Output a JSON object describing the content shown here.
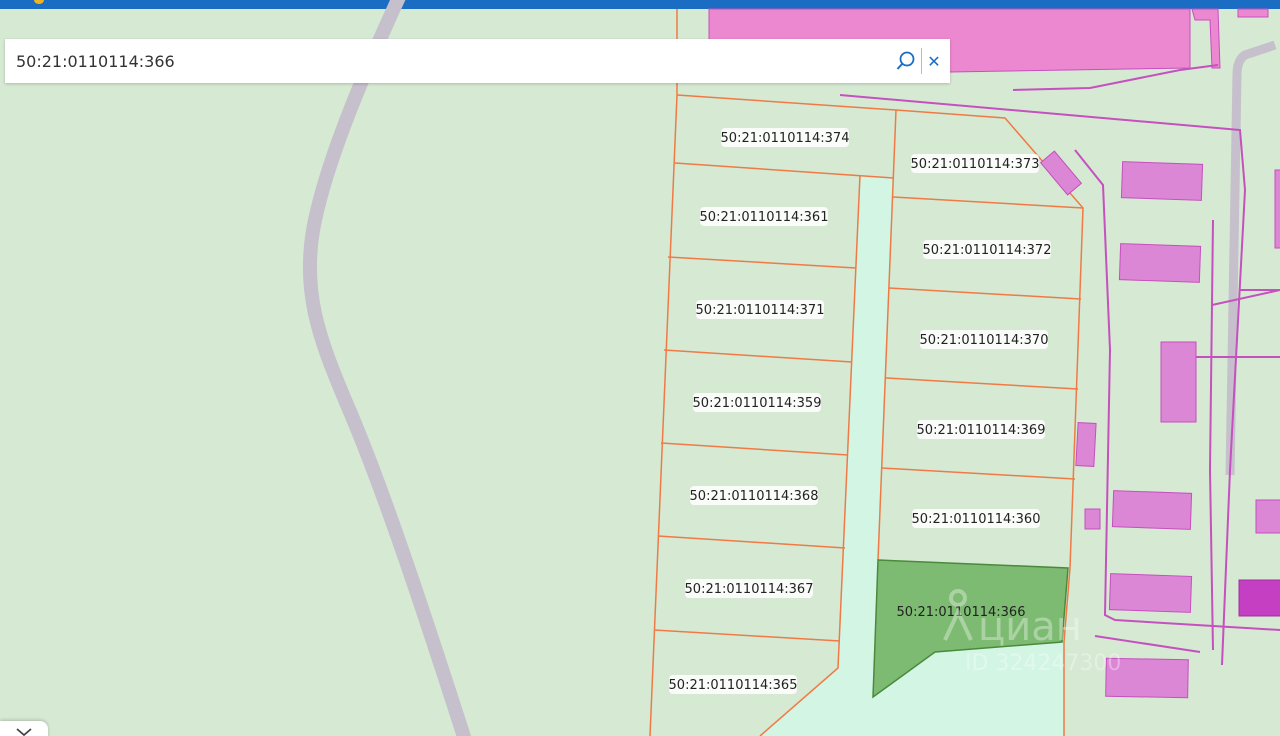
{
  "search": {
    "value": "50:21:0110114:366",
    "search_icon": "search-icon",
    "clear_icon": "close-icon"
  },
  "collapse_icon": "chevron-down-icon",
  "watermark": {
    "brand": "циан",
    "id": "ID 324247300"
  },
  "parcels": [
    {
      "id": "374",
      "label": "50:21:0110114:374"
    },
    {
      "id": "373",
      "label": "50:21:0110114:373"
    },
    {
      "id": "361",
      "label": "50:21:0110114:361"
    },
    {
      "id": "372",
      "label": "50:21:0110114:372"
    },
    {
      "id": "371",
      "label": "50:21:0110114:371"
    },
    {
      "id": "370",
      "label": "50:21:0110114:370"
    },
    {
      "id": "359",
      "label": "50:21:0110114:359"
    },
    {
      "id": "369",
      "label": "50:21:0110114:369"
    },
    {
      "id": "368",
      "label": "50:21:0110114:368"
    },
    {
      "id": "360",
      "label": "50:21:0110114:360"
    },
    {
      "id": "367",
      "label": "50:21:0110114:367"
    },
    {
      "id": "366",
      "label": "50:21:0110114:366",
      "selected": true
    },
    {
      "id": "365",
      "label": "50:21:0110114:365"
    }
  ],
  "colors": {
    "background": "#d6e9d3",
    "header": "#1a6dc3",
    "road": "#c6bfcc",
    "parcel_border": "#f07a45",
    "selected_fill": "#7dbb72",
    "selected_border": "#4a8a3c",
    "building_fill": "#dc86d6",
    "building_border": "#c550bf",
    "pink_zone": "#ec88cf",
    "strip": "#d3f5e4"
  }
}
